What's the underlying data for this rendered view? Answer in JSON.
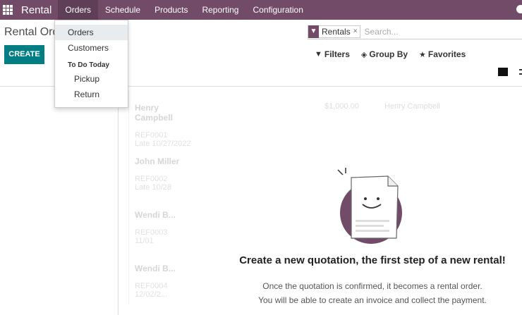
{
  "navbar": {
    "brand": "Rental",
    "menus": [
      "Orders",
      "Schedule",
      "Products",
      "Reporting",
      "Configuration"
    ]
  },
  "breadcrumb": "Rental Orders",
  "create_label": "CREATE",
  "search": {
    "facet_label": "Rentals",
    "facet_remove": "×",
    "placeholder": "Search..."
  },
  "filters": {
    "filters_label": "Filters",
    "groupby_label": "Group By",
    "favorites_label": "Favorites"
  },
  "orders_menu": {
    "orders": "Orders",
    "customers": "Customers",
    "todo_header": "To Do Today",
    "pickup": "Pickup",
    "return": "Return"
  },
  "ghost": {
    "cards": [
      {
        "name": "Henry Campbell",
        "ref": "REF0001",
        "line2": "Late 10/27/2022"
      },
      {
        "name": "John Miller",
        "ref": "REF0002",
        "line2": "Late 10/28"
      },
      {
        "name": "Wendi B...",
        "ref": "REF0003",
        "line2": "11/01"
      },
      {
        "name": "Wendi B...",
        "ref": "REF0004",
        "line2": "12/02/2..."
      }
    ],
    "top1": "$1,000.00",
    "top2": "Henry Campbell"
  },
  "helper": {
    "title": "Create a new quotation, the first step of a new rental!",
    "line1": "Once the quotation is confirmed, it becomes a rental order.",
    "line2": "You will be able to create an invoice and collect the payment."
  },
  "colors": {
    "brand": "#714B67",
    "primary": "#017e84"
  }
}
